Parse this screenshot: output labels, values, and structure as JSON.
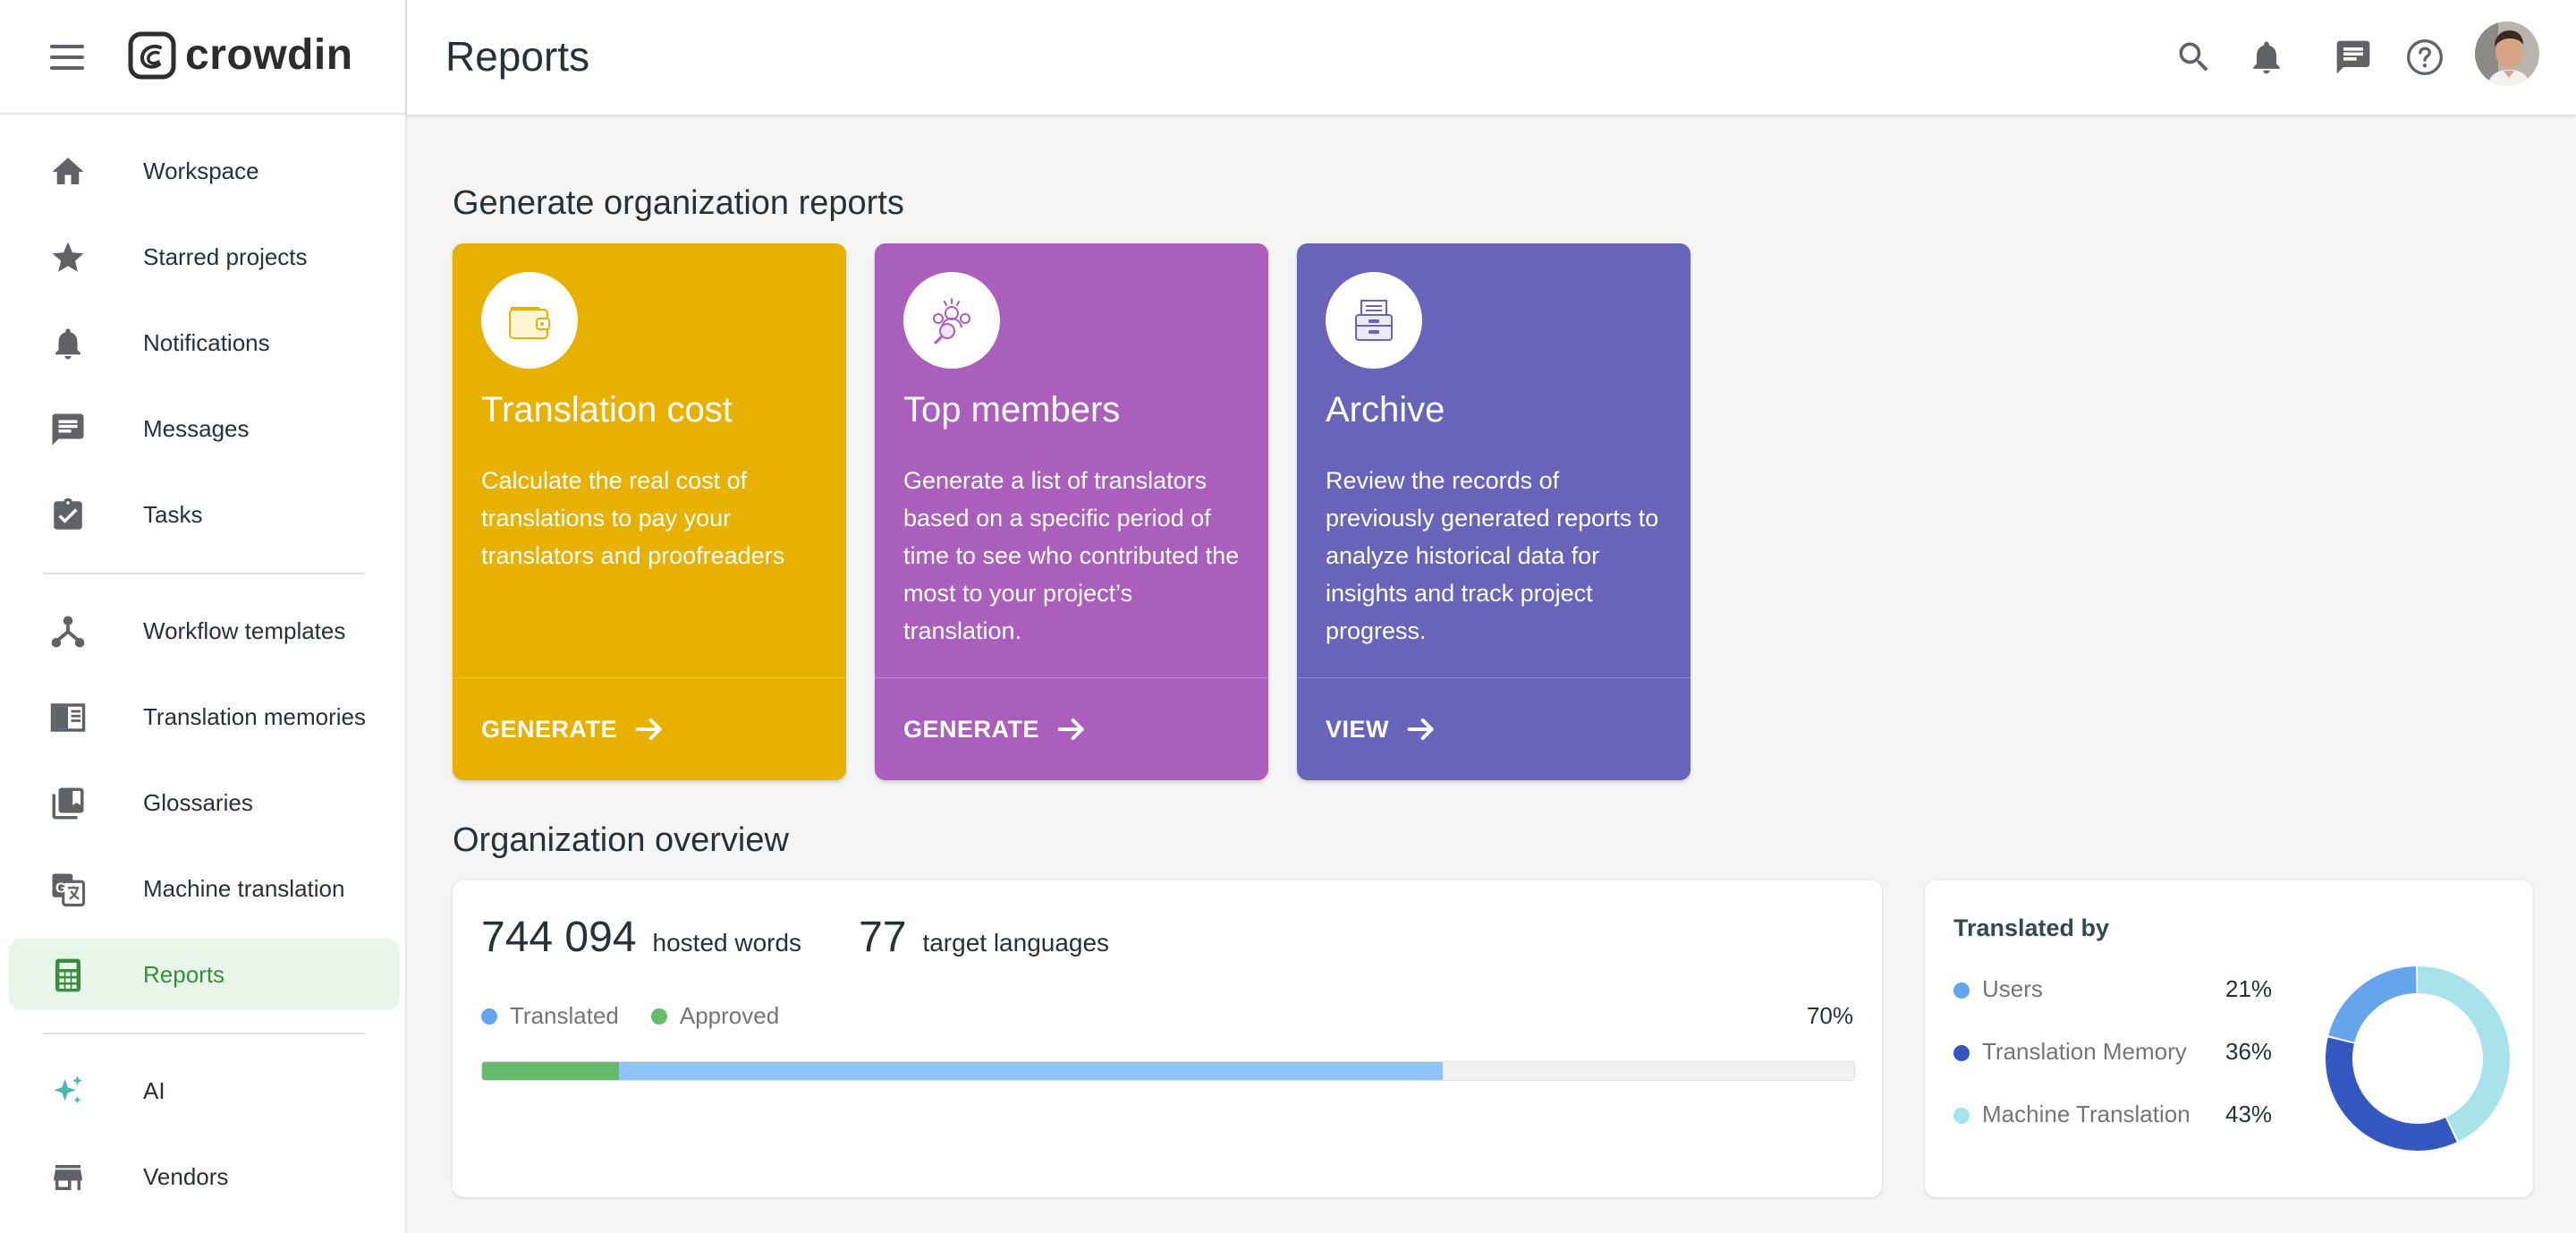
{
  "app": {
    "logo_text": "crowdin"
  },
  "sidebar": {
    "items": [
      {
        "label": "Workspace"
      },
      {
        "label": "Starred projects"
      },
      {
        "label": "Notifications"
      },
      {
        "label": "Messages"
      },
      {
        "label": "Tasks"
      },
      {
        "label": "Workflow templates"
      },
      {
        "label": "Translation memories"
      },
      {
        "label": "Glossaries"
      },
      {
        "label": "Machine translation"
      },
      {
        "label": "Reports"
      },
      {
        "label": "AI"
      },
      {
        "label": "Vendors"
      }
    ],
    "active_item": "Reports"
  },
  "header": {
    "title": "Reports"
  },
  "reports": {
    "title": "Generate organization reports",
    "cards": [
      {
        "title": "Translation cost",
        "description": "Calculate the real cost of translations to pay your translators and proofreaders",
        "action": "GENERATE",
        "color": "#e8b100",
        "icon": "wallet-icon"
      },
      {
        "title": "Top members",
        "description": "Generate a list of translators based on a specific period of time to see who contributed the most to your project’s translation.",
        "action": "GENERATE",
        "color": "#ab5fbd",
        "icon": "members-search-icon"
      },
      {
        "title": "Archive",
        "description": "Review the records of previously generated reports to analyze historical data for insights and track project progress.",
        "action": "VIEW",
        "color": "#6764ba",
        "icon": "archive-icon"
      }
    ]
  },
  "overview": {
    "title": "Organization overview",
    "hosted_words": "744 094",
    "hosted_words_label": "hosted words",
    "target_languages": "77",
    "target_languages_label": "target languages",
    "legend": [
      {
        "label": "Translated",
        "color": "#64a5eb"
      },
      {
        "label": "Approved",
        "color": "#66bb6a"
      }
    ],
    "progress_label": "70%",
    "progress": {
      "translated_percent": 70,
      "approved_percent": 10
    }
  },
  "translated_by": {
    "title": "Translated by",
    "items": [
      {
        "label": "Users",
        "value": "21%",
        "percent": 21,
        "color": "#64a5eb"
      },
      {
        "label": "Translation Memory",
        "value": "36%",
        "percent": 36,
        "color": "#3558c0"
      },
      {
        "label": "Machine Translation",
        "value": "43%",
        "percent": 43,
        "color": "#a8e3eb"
      }
    ]
  }
}
